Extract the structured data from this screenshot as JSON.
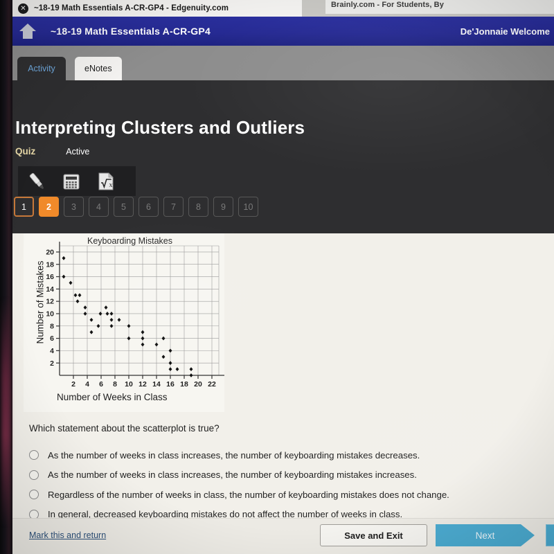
{
  "browser": {
    "tabs": [
      {
        "title": "~18-19 Math Essentials A-CR-GP4 - Edgenuity.com",
        "active": true,
        "close_icon": "close-icon"
      },
      {
        "title": "Brainly.com - For Students, By",
        "active": false
      }
    ]
  },
  "appbar": {
    "home_icon": "home-icon",
    "course_title": "~18-19 Math Essentials A-CR-GP4",
    "user": "De'Jonnaie Welcome"
  },
  "subtabs": [
    {
      "label": "Activity",
      "active": true
    },
    {
      "label": "eNotes",
      "active": false
    }
  ],
  "quiz": {
    "title": "Interpreting Clusters and Outliers",
    "type": "Quiz",
    "status": "Active",
    "tools": [
      {
        "name": "highlighter-icon",
        "label": "Highlighter"
      },
      {
        "name": "calculator-icon",
        "label": "Calculator"
      },
      {
        "name": "equation-editor-icon",
        "label": "Equation Editor"
      }
    ],
    "question_nav": [
      {
        "number": "1",
        "state": "answered"
      },
      {
        "number": "2",
        "state": "current"
      },
      {
        "number": "3",
        "state": "todo"
      },
      {
        "number": "4",
        "state": "todo"
      },
      {
        "number": "5",
        "state": "todo"
      },
      {
        "number": "6",
        "state": "todo"
      },
      {
        "number": "7",
        "state": "todo"
      },
      {
        "number": "8",
        "state": "todo"
      },
      {
        "number": "9",
        "state": "todo"
      },
      {
        "number": "10",
        "state": "todo"
      }
    ]
  },
  "question": {
    "prompt": "Which statement about the scatterplot is true?",
    "options": [
      {
        "id": "a",
        "label": "As the number of weeks in class increases, the number of keyboarding mistakes decreases.",
        "selected": false
      },
      {
        "id": "b",
        "label": "As the number of weeks in class increases, the number of keyboarding mistakes increases.",
        "selected": false
      },
      {
        "id": "c",
        "label": "Regardless of the number of weeks in class, the number of keyboarding mistakes does not change.",
        "selected": false
      },
      {
        "id": "d",
        "label": "In general, decreased keyboarding mistakes do not affect the number of weeks in class.",
        "selected": false
      }
    ]
  },
  "footer": {
    "mark_link": "Mark this and return",
    "save_label": "Save and Exit",
    "next_label": "Next"
  },
  "colors": {
    "appbar_blue": "#262a93",
    "accent_orange": "#f08a2a",
    "quiz_label_gold": "#e8d9a8",
    "next_blue": "#49a9cf",
    "panel_dark": "#2e2e30",
    "content_bg": "#f2f0ea"
  },
  "chart_data": {
    "type": "scatter",
    "title": "Keyboarding Mistakes",
    "xlabel": "Number of Weeks in Class",
    "ylabel": "Number of Mistakes",
    "xlim": [
      0,
      23
    ],
    "ylim": [
      0,
      21
    ],
    "xticks": [
      2,
      4,
      6,
      8,
      10,
      12,
      14,
      16,
      18,
      20,
      22
    ],
    "yticks": [
      2,
      4,
      6,
      8,
      10,
      12,
      14,
      16,
      18,
      20
    ],
    "grid": true,
    "legend": "none",
    "points": [
      [
        0.6,
        19
      ],
      [
        0.6,
        16
      ],
      [
        1.6,
        15
      ],
      [
        2.3,
        13
      ],
      [
        2.9,
        13
      ],
      [
        2.6,
        12
      ],
      [
        3.7,
        11
      ],
      [
        3.7,
        10
      ],
      [
        4.6,
        9
      ],
      [
        4.6,
        7
      ],
      [
        5.6,
        8
      ],
      [
        5.9,
        10
      ],
      [
        6.7,
        11
      ],
      [
        6.9,
        10
      ],
      [
        7.5,
        10
      ],
      [
        7.5,
        9
      ],
      [
        7.5,
        8
      ],
      [
        8.6,
        9
      ],
      [
        10,
        8
      ],
      [
        10,
        6
      ],
      [
        12,
        7
      ],
      [
        12,
        6
      ],
      [
        12,
        5
      ],
      [
        14,
        5
      ],
      [
        15,
        6
      ],
      [
        15,
        3
      ],
      [
        16,
        4
      ],
      [
        16,
        2
      ],
      [
        16,
        1
      ],
      [
        17,
        1
      ],
      [
        19,
        1
      ],
      [
        19,
        0
      ]
    ]
  }
}
